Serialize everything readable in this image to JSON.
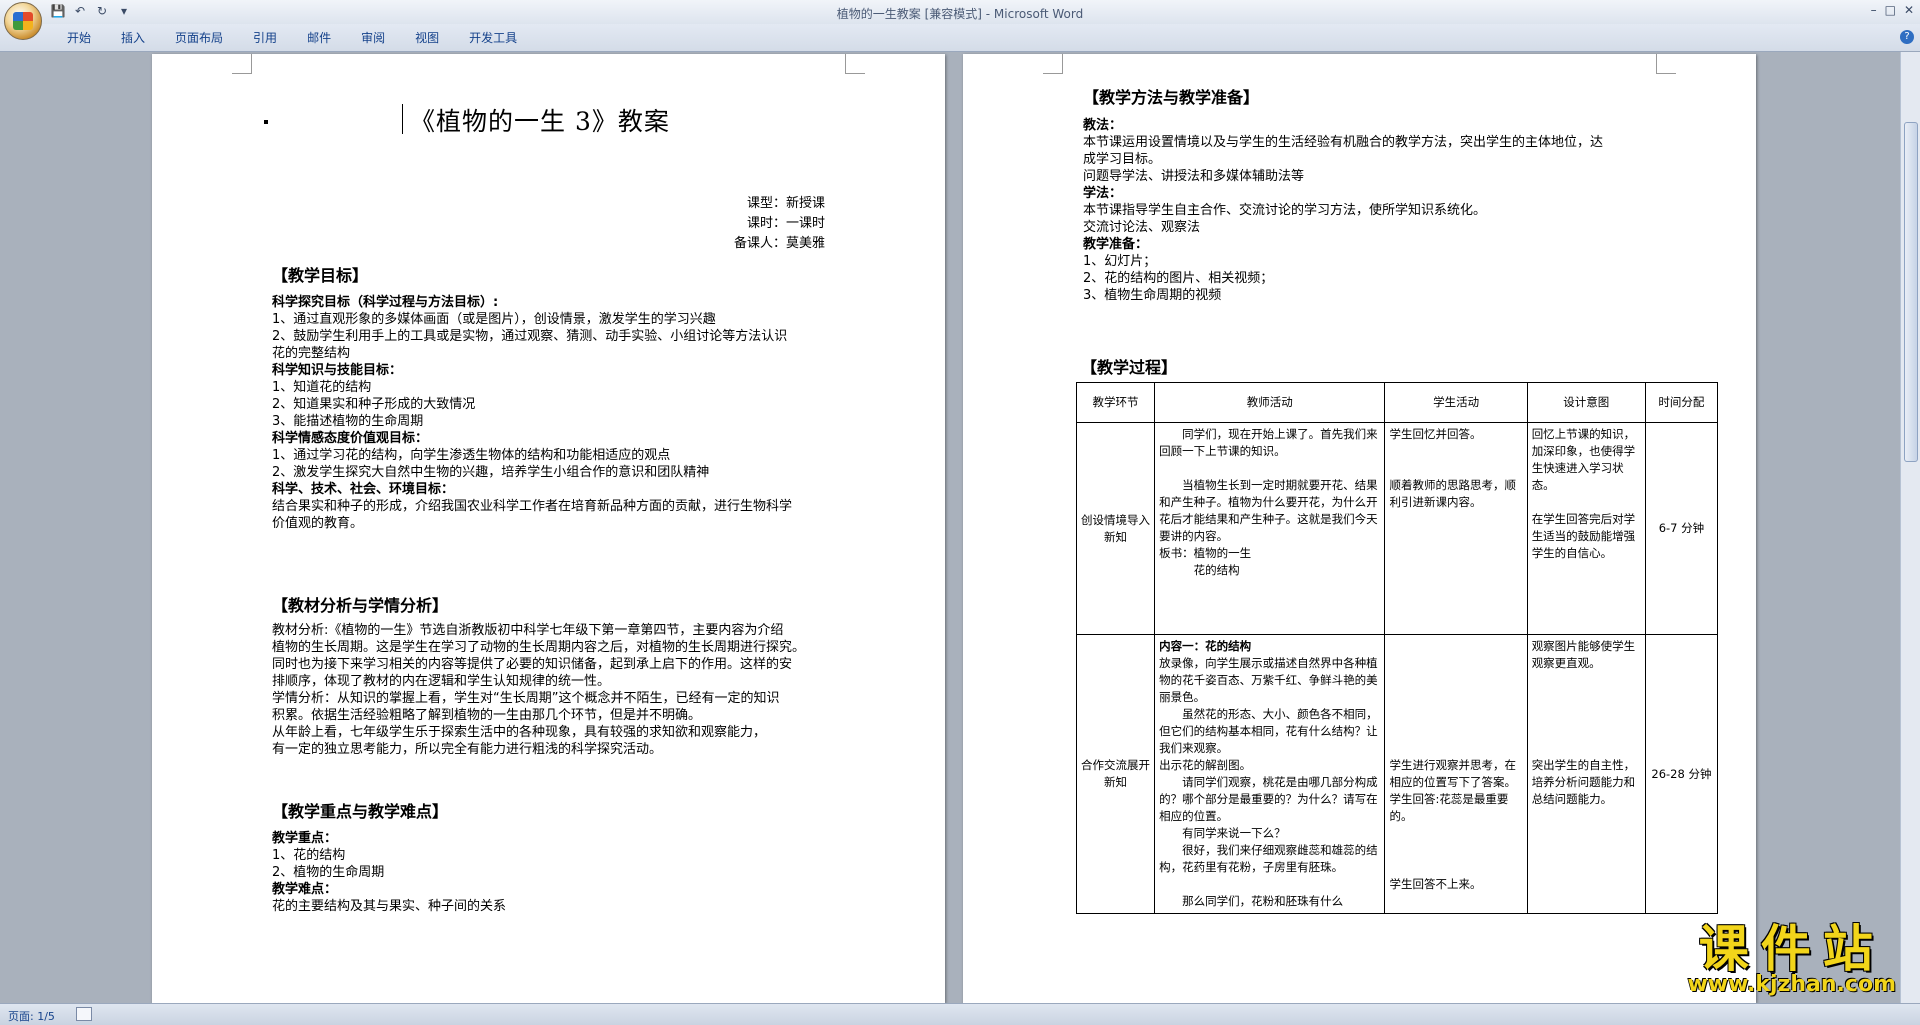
{
  "window": {
    "title": "植物的一生教案 [兼容模式] - Microsoft Word"
  },
  "ribbon": {
    "tabs": [
      "开始",
      "插入",
      "页面布局",
      "引用",
      "邮件",
      "审阅",
      "视图",
      "开发工具"
    ]
  },
  "status": {
    "page": "页面: 1/5"
  },
  "page1": {
    "title": "《植物的一生 3》教案",
    "meta": [
      "课型：新授课",
      "课时：一课时",
      "备课人：莫美雅"
    ],
    "sec1": "【教学目标】",
    "lines1": [
      "科学探究目标（科学过程与方法目标）:",
      "1、通过直观形象的多媒体画面（或是图片），创设情景，激发学生的学习兴趣",
      "2、鼓励学生利用手上的工具或是实物，通过观察、猜测、动手实验、小组讨论等方法认识",
      "花的完整结构",
      "科学知识与技能目标：",
      "1、知道花的结构",
      "2、知道果实和种子形成的大致情况",
      "3、能描述植物的生命周期",
      "科学情感态度价值观目标：",
      "1、通过学习花的结构，向学生渗透生物体的结构和功能相适应的观点",
      "2、激发学生探究大自然中生物的兴趣，培养学生小组合作的意识和团队精神",
      "科学、技术、社会、环境目标：",
      "结合果实和种子的形成，介绍我国农业科学工作者在培育新品种方面的贡献，进行生物科学",
      "价值观的教育。"
    ],
    "sec2": "【教材分析与学情分析】",
    "lines2": [
      "教材分析:《植物的一生》节选自浙教版初中科学七年级下第一章第四节，主要内容为介绍",
      "植物的生长周期。这是学生在学习了动物的生长周期内容之后，对植物的生长周期进行探究。",
      "同时也为接下来学习相关的内容等提供了必要的知识储备，起到承上启下的作用。这样的安",
      "排顺序，体现了教材的内在逻辑和学生认知规律的统一性。",
      "学情分析：从知识的掌握上看，学生对“生长周期”这个概念并不陌生，已经有一定的知识",
      "积累。依据生活经验粗略了解到植物的一生由那几个环节，但是并不明确。",
      "    从年龄上看，七年级学生乐于探索生活中的各种现象，具有较强的求知欲和观察能力，",
      "有一定的独立思考能力，所以完全有能力进行粗浅的科学探究活动。"
    ],
    "sec3": "【教学重点与教学难点】",
    "lines3": [
      "教学重点：",
      "1、花的结构",
      "2、植物的生命周期",
      "教学难点：",
      "花的主要结构及其与果实、种子间的关系"
    ]
  },
  "page2": {
    "sec1": "【教学方法与教学准备】",
    "lines1": [
      "教法：",
      "本节课运用设置情境以及与学生的生活经验有机融合的教学方法，突出学生的主体地位，达",
      "成学习目标。",
      "问题导学法、讲授法和多媒体辅助法等",
      "学法：",
      "本节课指导学生自主合作、交流讨论的学习方法，使所学知识系统化。",
      "交流讨论法、观察法",
      "教学准备：",
      "1、幻灯片；",
      "2、花的结构的图片、相关视频；",
      "3、植物生命周期的视频"
    ],
    "sec2": "【教学过程】",
    "table": {
      "headers": [
        "教学环节",
        "教师活动",
        "学生活动",
        "设计意图",
        "时间分配"
      ],
      "rows": [
        {
          "stage": "创设情境导入新知",
          "teacher": [
            "　　同学们，现在开始上课了。首先我们来回顾一下上节课的知识。",
            "",
            "　　当植物生长到一定时期就要开花、结果和产生种子。植物为什么要开花，为什么开花后才能结果和产生种子。这就是我们今天要讲的内容。",
            "板书：植物的一生",
            "　　　花的结构"
          ],
          "student": [
            "学生回忆并回答。",
            "",
            "",
            "顺着教师的思路思考，顺利引进新课内容。"
          ],
          "intent": [
            "回忆上节课的知识，加深印象，也使得学生快速进入学习状态。",
            "",
            "在学生回答完后对学生适当的鼓励能增强学生的自信心。"
          ],
          "time": "6-7 分钟"
        },
        {
          "stage": "合作交流展开新知",
          "teacher": [
            "内容一：花的结构",
            "放录像，向学生展示或描述自然界中各种植物的花千姿百态、万紫千红、争鲜斗艳的美丽景色。",
            "　　虽然花的形态、大小、颜色各不相同，但它们的结构基本相同，花有什么结构？让我们来观察。",
            "出示花的解剖图。",
            "　　请同学们观察，桃花是由哪几部分构成的？哪个部分是最重要的？为什么？请写在相应的位置。",
            "　　有同学来说一下么？",
            "　　很好，我们来仔细观察雌蕊和雄蕊的结构，花药里有花粉，子房里有胚珠。",
            "",
            "　　那么同学们，花粉和胚珠有什么"
          ],
          "student": [
            "",
            "",
            "",
            "",
            "",
            "",
            "",
            "学生进行观察并思考，在相应的位置写下了答案。",
            "学生回答:花蕊是最重要的。",
            "",
            "",
            "",
            "学生回答不上来。"
          ],
          "intent": [
            "观察图片能够使学生观察更直观。",
            "",
            "",
            "",
            "",
            "",
            "突出学生的自主性，培养分析问题能力和总结问题能力。"
          ],
          "time": "26-28 分钟"
        }
      ]
    }
  },
  "watermark": {
    "text": "课件站",
    "url": "www.kjzhan.com"
  }
}
